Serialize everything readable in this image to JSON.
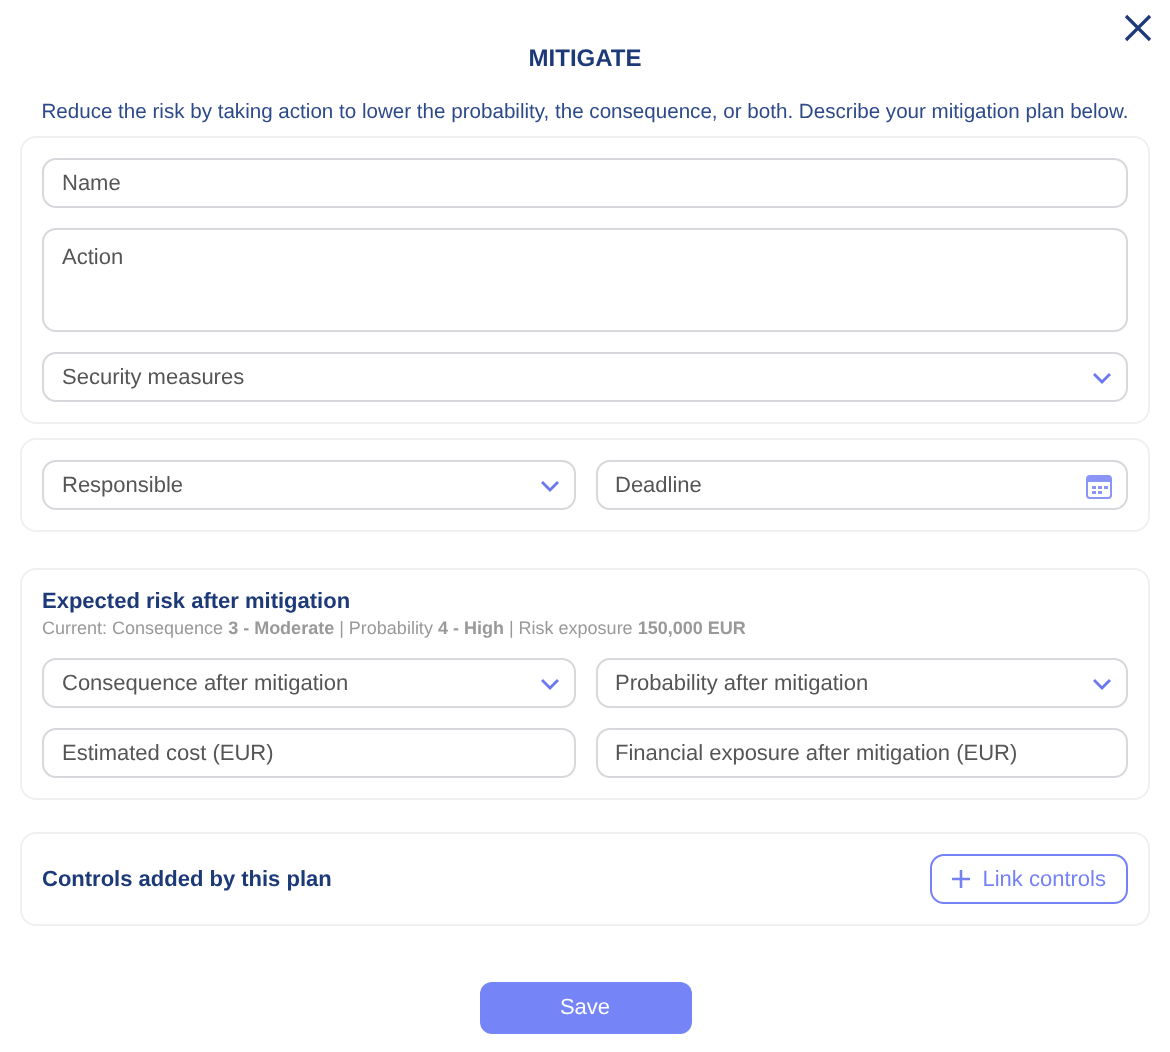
{
  "dialog": {
    "title": "MITIGATE",
    "description": "Reduce the risk by taking action to lower the probability, the consequence, or both. Describe your mitigation plan below."
  },
  "sections": [
    {
      "rows": [
        [
          {
            "kind": "input",
            "placeholder": "Name"
          }
        ],
        [
          {
            "kind": "textarea",
            "placeholder": "Action"
          }
        ],
        [
          {
            "kind": "select",
            "placeholder": "Security measures"
          }
        ]
      ]
    },
    {
      "rows": [
        [
          {
            "kind": "select",
            "placeholder": "Responsible"
          },
          {
            "kind": "date",
            "placeholder": "Deadline"
          }
        ]
      ]
    },
    {
      "heading": "Expected risk after mitigation",
      "current": "Current: Consequence **3 - Moderate** | Probability **4 - High** | Risk exposure **150,000 EUR**",
      "rows": [
        [
          {
            "kind": "select",
            "placeholder": "Consequence after mitigation"
          },
          {
            "kind": "select",
            "placeholder": "Probability after mitigation"
          }
        ],
        [
          {
            "kind": "input",
            "placeholder": "Estimated cost (EUR)"
          },
          {
            "kind": "input",
            "placeholder": "Financial exposure after mitigation (EUR)"
          }
        ]
      ]
    }
  ],
  "controls": {
    "heading": "Controls added by this plan",
    "button": "Link controls"
  },
  "save_button": "Save"
}
